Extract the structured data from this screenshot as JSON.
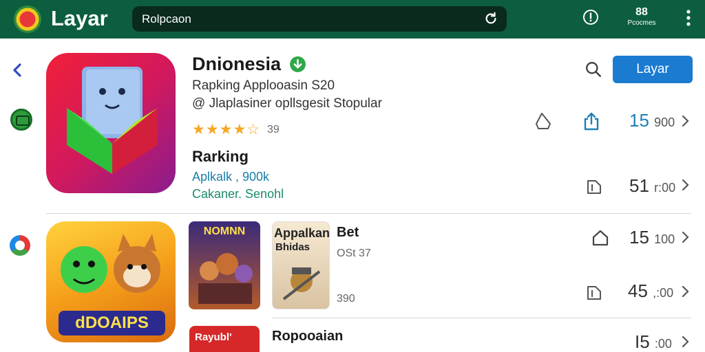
{
  "header": {
    "title": "Layar",
    "search_text": "Rolpcaon",
    "counter_value": "88",
    "counter_label": "Pcocmes",
    "icons": [
      "store-logo-icon",
      "refresh-icon",
      "alert-icon",
      "kebab-menu-icon"
    ]
  },
  "rail": {
    "icons": [
      "back-chevron-icon",
      "category-icon",
      "browser-icon"
    ]
  },
  "app": {
    "name": "Dnionesia",
    "subtitle1": "Rapking Applooasin S20",
    "subtitle2": "@ Jlaplasiner opllsgesit Stopular",
    "stars": "★★★★☆",
    "rating_count": "39",
    "ranking_title": "Rarking",
    "ranking_line1": "Aplkalk , 900k",
    "ranking_line2": "Cakaner. Senohl",
    "action_label": "Layar",
    "colors": {
      "accent": "#1a7bd1",
      "header": "#0d5e3f",
      "star": "#f5a623"
    }
  },
  "metrics": [
    {
      "big": "15",
      "small": "900"
    },
    {
      "big": "51",
      "small": "r:00"
    },
    {
      "big": "15",
      "small": "100"
    },
    {
      "big": "45",
      "small": ",:00"
    },
    {
      "big": "I5",
      "small": ":00"
    }
  ],
  "list": {
    "big_tile_label": "dDOAIPS",
    "thumb1_label": "NOMNN",
    "thumb2_title": "Appalkan",
    "thumb2_sub": "Bhidas",
    "thumb3_label": "Rayubl'",
    "row2_title": "Bet",
    "row2_sub": "OSt 37",
    "row2_count": "390",
    "row3_title": "Ropooaian"
  }
}
